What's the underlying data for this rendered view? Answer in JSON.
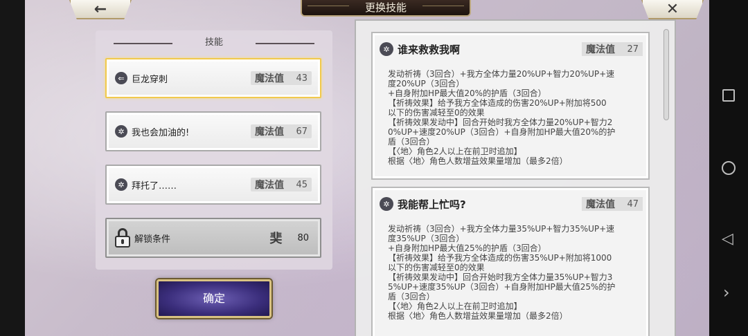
{
  "header": {
    "title": "更换技能",
    "back_icon": "←",
    "close_icon": "✕"
  },
  "left_panel": {
    "section_title": "技能",
    "skills": [
      {
        "name": "巨龙穿刺",
        "mp_label": "魔法值",
        "mp": "43",
        "icon": "⇐",
        "selected": true
      },
      {
        "name": "我也会加油的!",
        "mp_label": "魔法值",
        "mp": "67",
        "icon": "✲"
      },
      {
        "name": "拜托了……",
        "mp_label": "魔法值",
        "mp": "45",
        "icon": "✲"
      }
    ],
    "locked": {
      "label": "解锁条件",
      "rank_icon": "奜",
      "value": "80"
    },
    "confirm_label": "确定"
  },
  "right_panel": {
    "cards": [
      {
        "title": "谁来救救我啊",
        "mp_label": "魔法值",
        "mp": "27",
        "icon": "✲",
        "lines": [
          "发动祈祷（3回合）+我方全体力量20%UP+智力20%UP+速",
          "度20%UP（3回合）",
          "+自身附加HP最大值20%的护盾（3回合）",
          "【祈祷效果】给予我方全体造成的伤害20%UP+附加将500",
          "以下的伤害减轻至0的效果",
          "【祈祷效果发动中】回合开始时我方全体力量20%UP+智力2",
          "0%UP+速度20%UP（3回合）+自身附加HP最大值20%的护",
          "盾（3回合）",
          "【〈地〉角色2人以上在前卫时追加】",
          "根据〈地〉角色人数增益效果量增加（最多2倍）"
        ]
      },
      {
        "title": "我能帮上忙吗?",
        "mp_label": "魔法值",
        "mp": "47",
        "icon": "✲",
        "lines": [
          "发动祈祷（3回合）+我方全体力量35%UP+智力35%UP+速",
          "度35%UP（3回合）",
          "+自身附加HP最大值25%的护盾（3回合）",
          "【祈祷效果】给予我方全体造成的伤害35%UP+附加将1000",
          "以下的伤害减轻至0的效果",
          "【祈祷效果发动中】回合开始时我方全体力量35%UP+智力3",
          "5%UP+速度35%UP（3回合）+自身附加HP最大值25%的护",
          "盾（3回合）",
          "【〈地〉角色2人以上在前卫时追加】",
          "根据〈地〉角色人数增益效果量增加（最多2倍）"
        ]
      }
    ]
  },
  "nav_bar": {
    "back_glyph": "◁",
    "more_glyph": "›"
  }
}
